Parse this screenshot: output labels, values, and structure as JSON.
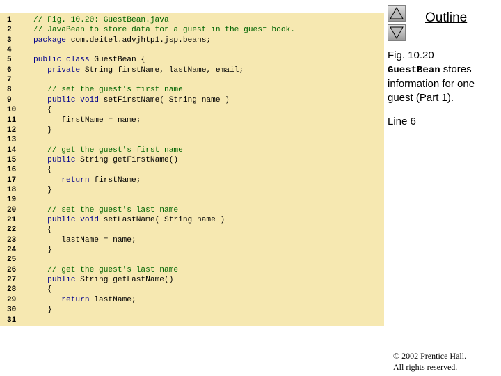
{
  "code_lines": [
    {
      "n": "1",
      "parts": [
        {
          "t": "// Fig. 10.20: GuestBean.java",
          "c": "cmt"
        }
      ]
    },
    {
      "n": "2",
      "parts": [
        {
          "t": "// JavaBean to store data for a guest in the guest book.",
          "c": "cmt"
        }
      ]
    },
    {
      "n": "3",
      "parts": [
        {
          "t": "package",
          "c": "kw"
        },
        {
          "t": " com.deitel.advjhtp1.jsp.beans;",
          "c": "plain"
        }
      ]
    },
    {
      "n": "4",
      "parts": []
    },
    {
      "n": "5",
      "parts": [
        {
          "t": "public class",
          "c": "kw"
        },
        {
          "t": " GuestBean {",
          "c": "plain"
        }
      ]
    },
    {
      "n": "6",
      "parts": [
        {
          "t": "   private",
          "c": "kw"
        },
        {
          "t": " String firstName, lastName, email;",
          "c": "plain"
        }
      ]
    },
    {
      "n": "7",
      "parts": []
    },
    {
      "n": "8",
      "parts": [
        {
          "t": "   // set the guest's first name",
          "c": "cmt"
        }
      ]
    },
    {
      "n": "9",
      "parts": [
        {
          "t": "   public void",
          "c": "kw"
        },
        {
          "t": " setFirstName( String name )",
          "c": "plain"
        }
      ]
    },
    {
      "n": "10",
      "parts": [
        {
          "t": "   {",
          "c": "plain"
        }
      ]
    },
    {
      "n": "11",
      "parts": [
        {
          "t": "      firstName = name;",
          "c": "plain"
        }
      ]
    },
    {
      "n": "12",
      "parts": [
        {
          "t": "   }",
          "c": "plain"
        }
      ]
    },
    {
      "n": "13",
      "parts": []
    },
    {
      "n": "14",
      "parts": [
        {
          "t": "   // get the guest's first name",
          "c": "cmt"
        }
      ]
    },
    {
      "n": "15",
      "parts": [
        {
          "t": "   public",
          "c": "kw"
        },
        {
          "t": " String getFirstName()",
          "c": "plain"
        }
      ]
    },
    {
      "n": "16",
      "parts": [
        {
          "t": "   {",
          "c": "plain"
        }
      ]
    },
    {
      "n": "17",
      "parts": [
        {
          "t": "      return",
          "c": "kw"
        },
        {
          "t": " firstName;",
          "c": "plain"
        }
      ]
    },
    {
      "n": "18",
      "parts": [
        {
          "t": "   }",
          "c": "plain"
        }
      ]
    },
    {
      "n": "19",
      "parts": []
    },
    {
      "n": "20",
      "parts": [
        {
          "t": "   // set the guest's last name",
          "c": "cmt"
        }
      ]
    },
    {
      "n": "21",
      "parts": [
        {
          "t": "   public void",
          "c": "kw"
        },
        {
          "t": " setLastName( String name )",
          "c": "plain"
        }
      ]
    },
    {
      "n": "22",
      "parts": [
        {
          "t": "   {",
          "c": "plain"
        }
      ]
    },
    {
      "n": "23",
      "parts": [
        {
          "t": "      lastName = name;",
          "c": "plain"
        }
      ]
    },
    {
      "n": "24",
      "parts": [
        {
          "t": "   }",
          "c": "plain"
        }
      ]
    },
    {
      "n": "25",
      "parts": []
    },
    {
      "n": "26",
      "parts": [
        {
          "t": "   // get the guest's last name",
          "c": "cmt"
        }
      ]
    },
    {
      "n": "27",
      "parts": [
        {
          "t": "   public",
          "c": "kw"
        },
        {
          "t": " String getLastName()",
          "c": "plain"
        }
      ]
    },
    {
      "n": "28",
      "parts": [
        {
          "t": "   {",
          "c": "plain"
        }
      ]
    },
    {
      "n": "29",
      "parts": [
        {
          "t": "      return",
          "c": "kw"
        },
        {
          "t": " lastName;",
          "c": "plain"
        }
      ]
    },
    {
      "n": "30",
      "parts": [
        {
          "t": "   }",
          "c": "plain"
        }
      ]
    },
    {
      "n": "31",
      "parts": []
    }
  ],
  "nav": {
    "up_icon": "triangle-up",
    "down_icon": "triangle-down"
  },
  "outline_label": "Outline",
  "caption": {
    "fig": "Fig. 10.20",
    "class_name": "GuestBean",
    "rest": " stores information for one guest (Part 1)."
  },
  "line_ref": "Line 6",
  "copyright": {
    "line1": "© 2002 Prentice Hall.",
    "line2": "All rights reserved."
  },
  "colors": {
    "panel": "#f6e8b1",
    "comment": "#006400",
    "keyword": "#00008b"
  }
}
